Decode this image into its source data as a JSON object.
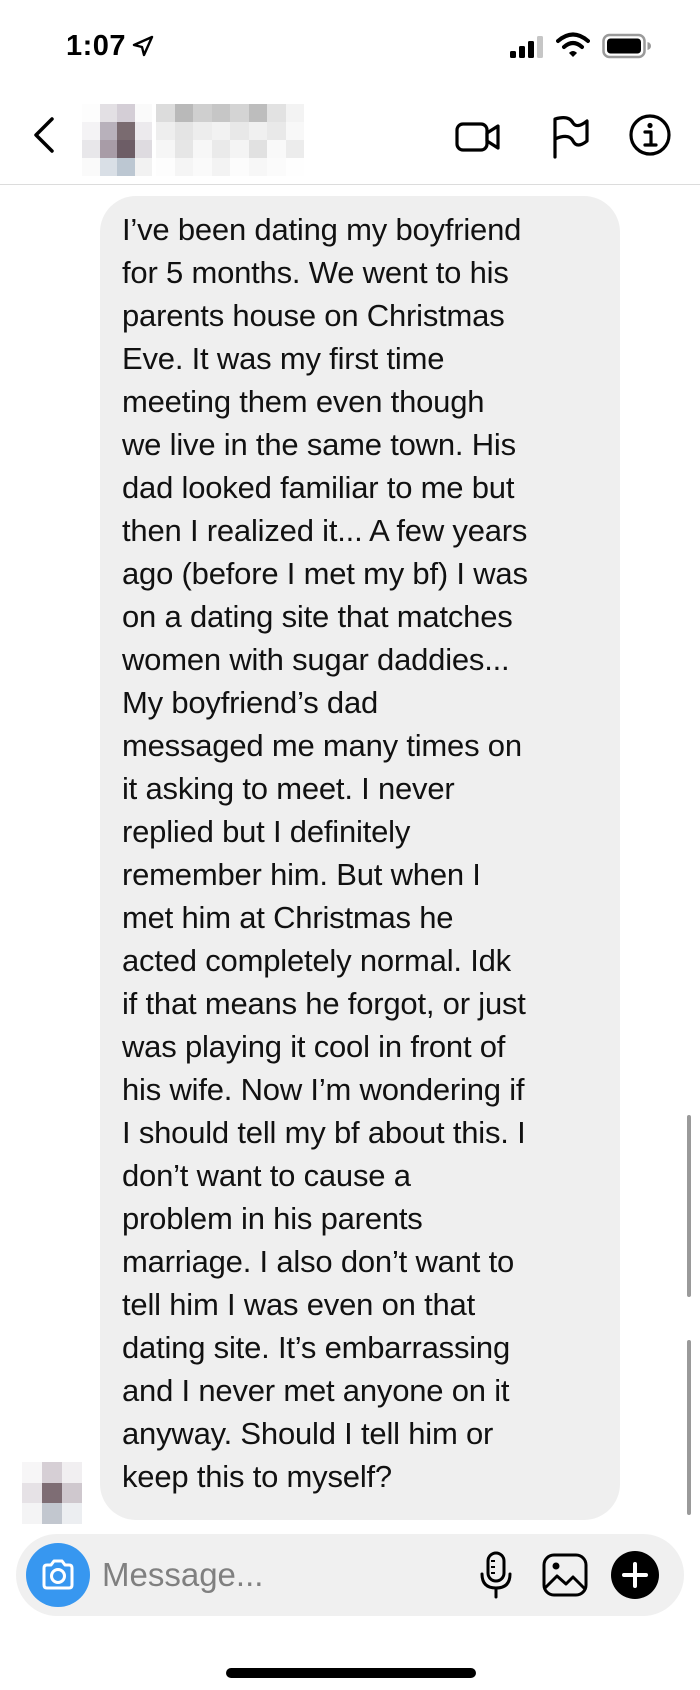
{
  "status_bar": {
    "time": "1:07"
  },
  "header": {
    "contact_name_hidden": true
  },
  "message": {
    "text": "I’ve been dating my boyfriend\nfor 5 months. We went to his\nparents house on Christmas\nEve. It was my first time\nmeeting them even though\nwe live in the same town. His\ndad looked familiar to me but\nthen I realized it... A few years\nago (before I met my bf) I was\non a dating site that matches\nwomen with sugar daddies...\nMy boyfriend’s dad\nmessaged me many times on\nit asking to meet. I never\nreplied but I definitely\nremember him. But when I\nmet him at Christmas he\nacted completely normal. Idk\nif that means he forgot, or just\nwas playing it cool in front of\nhis wife. Now I’m wondering if\nI should tell my bf about this. I\ndon’t want to cause a\nproblem in his parents\nmarriage. I also don’t want to\ntell him I was even on that\ndating site. It’s embarrassing\nand I never met anyone on it\nanyway. Should I tell him or\nkeep this to myself?"
  },
  "composer": {
    "placeholder": "Message..."
  },
  "icons": {
    "status": [
      "location-arrow-icon",
      "signal-icon",
      "wifi-icon",
      "battery-icon"
    ],
    "header": [
      "back-chevron-icon",
      "video-call-icon",
      "flag-icon",
      "info-icon"
    ],
    "composer": [
      "camera-icon",
      "microphone-icon",
      "gallery-icon",
      "plus-icon"
    ]
  },
  "colors": {
    "accent": "#3797f0",
    "bubble": "#efefef",
    "composer_bg": "#f0f0f0"
  }
}
